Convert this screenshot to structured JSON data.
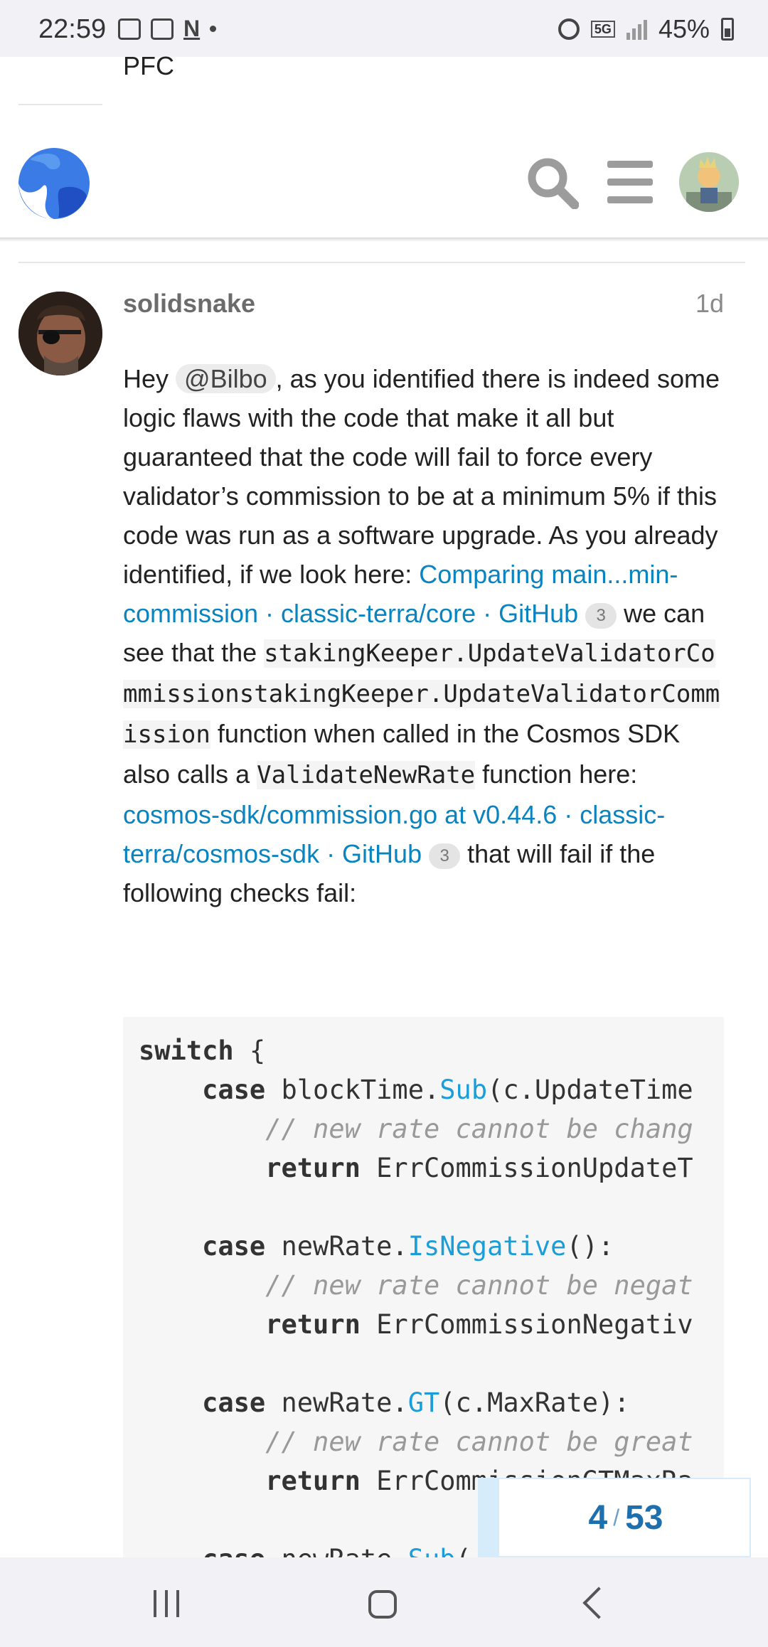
{
  "status_bar": {
    "time": "22:59",
    "battery": "45%",
    "network": "5G",
    "icons": [
      "image-icon",
      "voicemail-icon",
      "n-icon",
      "dot-icon",
      "alarm-icon",
      "5g-icon",
      "signal-icon",
      "battery-icon"
    ]
  },
  "header": {
    "prev_title": "PFC",
    "icons": [
      "site-logo-icon",
      "search-icon",
      "hamburger-menu-icon",
      "user-avatar"
    ]
  },
  "post": {
    "username": "solidsnake",
    "date": "1d",
    "text_hey": "Hey ",
    "mention": "@Bilbo",
    "text_1": ", as you identified there is indeed some logic flaws with the code that make it all but guaranteed that the code will fail to force every validator’s commission to be at a minimum 5% if this code was run as a software upgrade. As you already identified, if we look here: ",
    "link_1": "Comparing main...min-commission · classic-terra/core · GitHub",
    "link_1_clicks": "3",
    "text_2": " we can see that the ",
    "code_1": "stakingKeeper.UpdateValidatorCommissionstakingKeeper.UpdateValidatorCommission",
    "text_3": " function when called in the Cosmos SDK also calls a ",
    "code_2": "ValidateNewRate",
    "text_4": " function here: ",
    "link_2": "cosmos-sdk/commission.go at v0.44.6 · classic-terra/cosmos-sdk · GitHub",
    "link_2_clicks": "3",
    "text_5": " that will fail if the following checks fail:"
  },
  "code_block": {
    "l1_kw": "switch",
    "l1_rest": " {",
    "l2_kw": "case",
    "l2_a": " blockTime.",
    "l2_fn": "Sub",
    "l2_b": "(c.UpdateTime",
    "l3_cm": "// new rate cannot be chang",
    "l4_kw": "return",
    "l4_rest": " ErrCommissionUpdateT",
    "l6_kw": "case",
    "l6_a": " newRate.",
    "l6_fn": "IsNegative",
    "l6_b": "():",
    "l7_cm": "// new rate cannot be negat",
    "l8_kw": "return",
    "l8_rest": " ErrCommissionNegativ",
    "l10_kw": "case",
    "l10_a": " newRate.",
    "l10_fn": "GT",
    "l10_b": "(c.MaxRate):",
    "l11_cm": "// new rate cannot be great",
    "l12_kw": "return",
    "l12_rest": " ErrCommissionGTMaxRa",
    "l14_kw": "case",
    "l14_a": " newRate.",
    "l14_fn": "Sub",
    "l14_b": "("
  },
  "timeline": {
    "current": "4",
    "separator": "/",
    "total": "53"
  },
  "colors": {
    "link": "#0a84c0",
    "code_function": "#1b9ed8",
    "timeline_text": "#1e6fae",
    "timeline_accent": "#d6ecfa"
  }
}
